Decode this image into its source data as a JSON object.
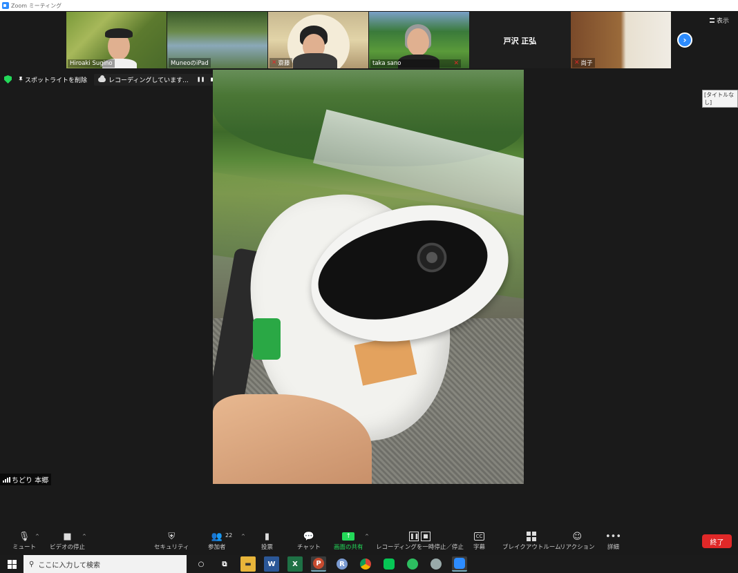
{
  "window": {
    "title": "Zoom ミーティング"
  },
  "participants": [
    {
      "name": "Hiroaki Sugino",
      "muted": false
    },
    {
      "name": "MuneoのiPad",
      "muted": false
    },
    {
      "name": "齋藤",
      "muted": true
    },
    {
      "name": "taka sano",
      "muted": true
    },
    {
      "name": "戸沢 正弘",
      "muted": true,
      "video_off": true
    },
    {
      "name": "尚子",
      "muted": true
    }
  ],
  "header": {
    "view_label": "表示"
  },
  "status": {
    "spotlight_remove": "スポットライトを削除",
    "recording": "レコーディングしています...",
    "pause_glyph": "❚❚",
    "stop_glyph": "■"
  },
  "title_tag": "[タイトルなし]",
  "spotlight": {
    "name": "ちどり 本郷"
  },
  "toolbar": {
    "mute": "ミュート",
    "video_stop": "ビデオの停止",
    "security": "セキュリティ",
    "participants": "参加者",
    "participants_count": "22",
    "vote": "投票",
    "chat": "チャット",
    "share": "画面の共有",
    "recording_control": "レコーディングを一時停止／停止",
    "captions": "字幕",
    "cc_glyph": "CC",
    "breakout": "ブレイクアウトルーム",
    "reaction": "リアクション",
    "more": "詳細",
    "end": "終了"
  },
  "taskbar": {
    "search_placeholder": "ここに入力して検索",
    "apps": [
      "W",
      "X",
      "P",
      "R"
    ]
  },
  "colors": {
    "accent_blue": "#2d8cff",
    "share_green": "#23d959",
    "end_red": "#e02828"
  }
}
